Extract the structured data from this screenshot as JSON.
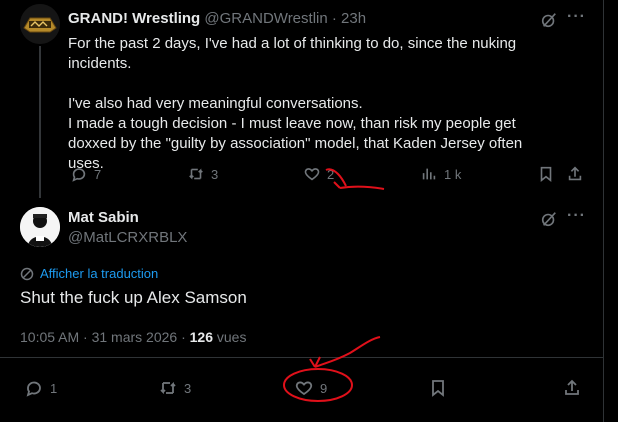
{
  "post1": {
    "author_name": "GRAND! Wrestling",
    "author_handle": "@GRANDWrestlin",
    "time": "23h",
    "body": [
      "For the past 2 days, I've had a lot of thinking to do, since the nuking incidents.",
      "I've also had very meaningful conversations.\nI made a tough decision - I must leave now, than risk my people get doxxed by the \"guilty by association\" model, that Kaden Jersey often uses."
    ],
    "replies": "7",
    "reposts": "3",
    "likes": "2",
    "views": "1 k"
  },
  "post2": {
    "author_name": "Mat Sabin",
    "author_handle": "@MatLCRXRBLX",
    "translate_label": "Afficher la traduction",
    "body": "Shut the fuck up Alex Samson",
    "timestamp": "10:05 AM · 31 mars 2026 · ",
    "views_count": "126",
    "views_label": " vues",
    "replies": "1",
    "reposts": "3",
    "likes": "9"
  },
  "icons": {
    "more": "more-icon",
    "grok": "grok-slash-icon",
    "reply": "reply-icon",
    "repost": "repost-icon",
    "like": "heart-icon",
    "views": "analytics-icon",
    "bookmark": "bookmark-icon",
    "share": "share-icon"
  },
  "colors": {
    "background": "#000000",
    "text": "#e7e9ea",
    "muted": "#71767b",
    "link": "#1d9bf0",
    "annotation": "#e0101a"
  }
}
